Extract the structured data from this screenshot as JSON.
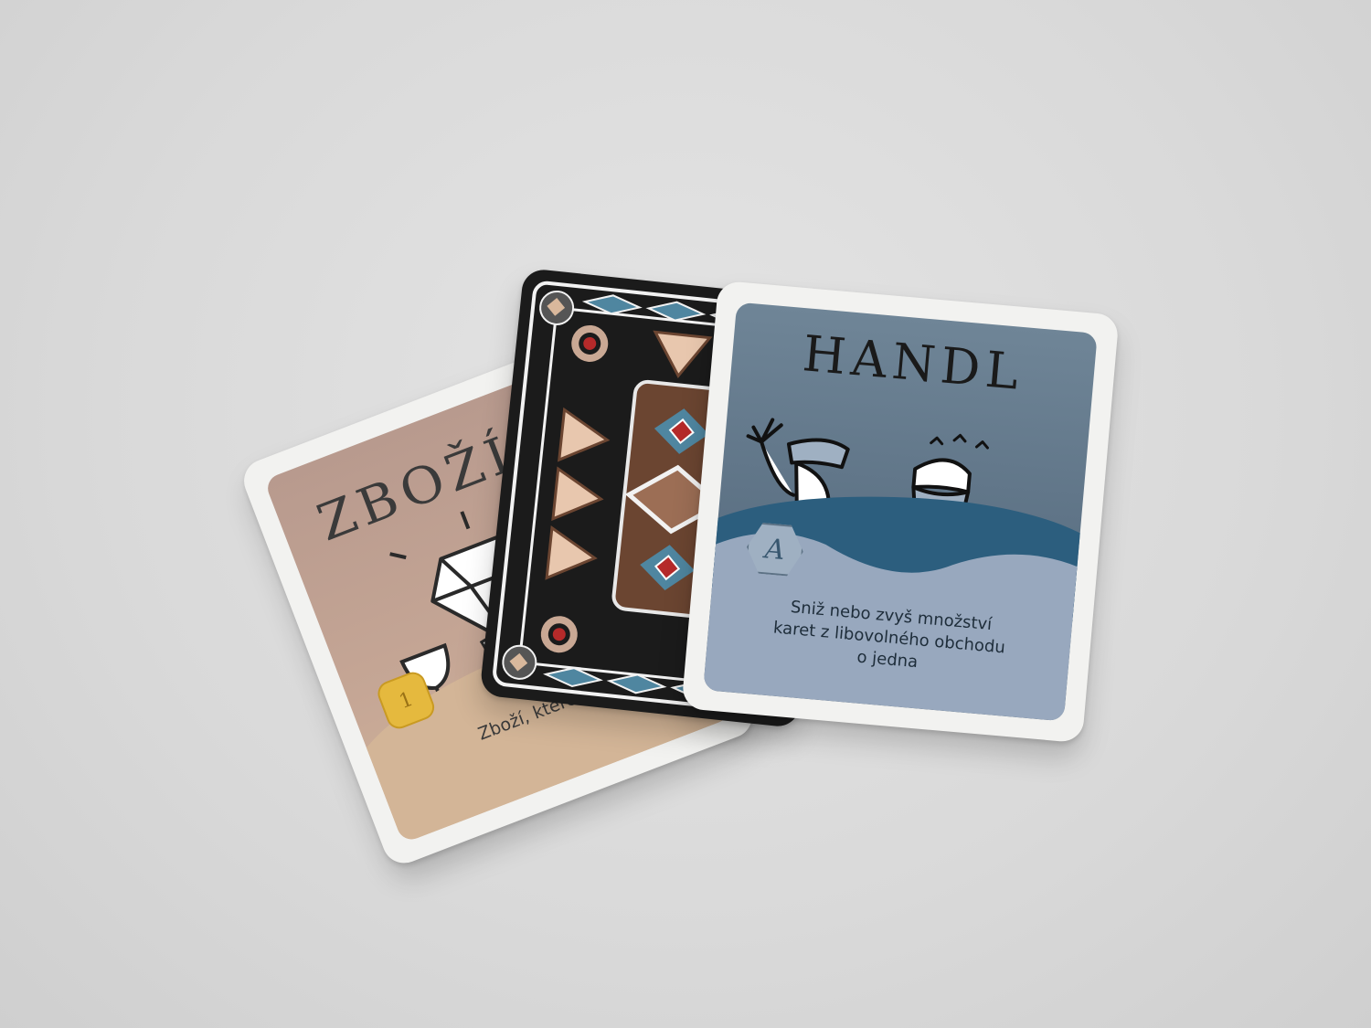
{
  "cards": {
    "left": {
      "title": "ZBOŽÍ",
      "coin_value": "1",
      "description_visible": "Zboží, které m"
    },
    "middle": {
      "side": "card-back"
    },
    "right": {
      "title": "HANDL",
      "badge_letter": "A",
      "description_lines": [
        "Sniž nebo zvyš množství",
        "karet z libovolného obchodu",
        "o jedna"
      ]
    }
  },
  "colors": {
    "background": "#d9d9d9",
    "card_border": "#f2f2f0",
    "zbozi_face": "#b89a8e",
    "handl_face": "#5d7285",
    "handl_wave": "#2c5e7e",
    "coin": "#e5b93e",
    "back_black": "#1b1b1b",
    "back_brown": "#6b4531",
    "back_blue": "#4f86a0",
    "back_red": "#b52a2a"
  },
  "icons": [
    "diamond-gem-icon",
    "goblet-icon",
    "carpet-icon",
    "coin-icon",
    "traders-illustration-icon",
    "action-badge-icon"
  ]
}
